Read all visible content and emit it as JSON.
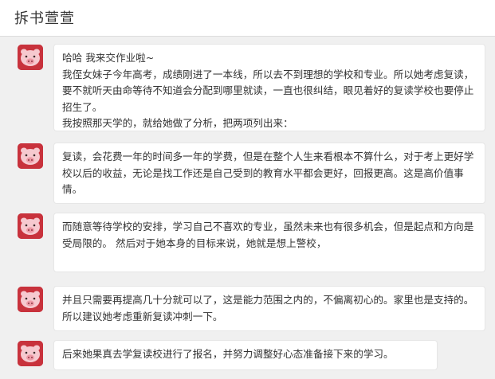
{
  "header": {
    "title": "拆书萱萱"
  },
  "messages": [
    {
      "lines": [
        "哈哈 我来交作业啦~",
        "我侄女妹子今年高考，成绩刚进了一本线，所以去不到理想的学校和专业。所以她考虑复读，要不就听天由命等待不知道会分配到哪里就读，一直也很纠结，眼见着好的复读学校也要停止招生了。",
        "我按照那天学的，就给她做了分析，把两项列出来："
      ]
    },
    {
      "lines": [
        "复读，会花费一年的时间多一年的学费，但是在整个人生来看根本不算什么，对于考上更好学校以后的收益，无论是找工作还是自己受到的教育水平都会更好，回报更高。这是高价值事情。"
      ]
    },
    {
      "lines": [
        "而随意等待学校的安排，学习自己不喜欢的专业，虽然未来也有很多机会，但是起点和方向是受局限的。 然后对于她本身的目标来说，她就是想上警校，"
      ]
    },
    {
      "lines": [
        "并且只需要再提高几十分就可以了，这是能力范围之内的，不偏离初心的。家里也是支持的。所以建议她考虑重新复读冲刺一下。"
      ]
    },
    {
      "lines": [
        "后来她果真去学复读校进行了报名，并努力调整好心态准备接下来的学习。"
      ]
    }
  ]
}
